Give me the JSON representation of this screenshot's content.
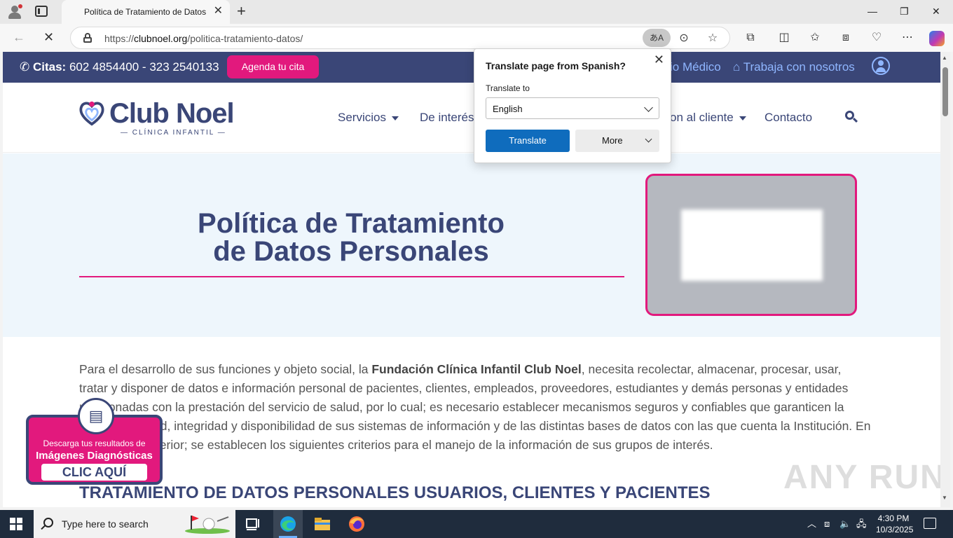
{
  "browser": {
    "tab_title": "Política de Tratamiento de Datos P",
    "url_prefix": "https://",
    "url_domain": "clubnoel.org",
    "url_path": "/politica-tratamiento-datos/",
    "translate_pill": "あA"
  },
  "topbar": {
    "citas_label": "Citas:",
    "phones": "602 4854400 - 323 2540133",
    "agenda_button": "Agenda tu cita",
    "link_medico": "io Médico",
    "link_trabaja": "Trabaja con nosotros"
  },
  "header": {
    "logo_name": "Club Noel",
    "logo_sub": "— CLÍNICA INFANTIL —",
    "menu": {
      "servicios": "Servicios",
      "interes": "De interés",
      "cliente": "on al cliente",
      "contacto": "Contacto"
    }
  },
  "hero": {
    "title_line1": "Política de Tratamiento",
    "title_line2": "de Datos Personales"
  },
  "content": {
    "para_intro": "Para el desarrollo de sus funciones y objeto social, la ",
    "para_bold": "Fundación Clínica Infantil Club Noel",
    "para_rest": ", necesita recolectar, almacenar, procesar, usar, tratar y disponer de datos e información personal de pacientes, clientes, empleados, proveedores, estudiantes y demás personas y entidades relacionadas con la prestación del servicio de salud, por lo cual; es necesario establecer mecanismos seguros y confiables que garanticen la confidencialidad, integridad y disponibilidad de sus sistemas de información y de las distintas bases de datos con las que cuenta la Institución. En virtud de lo anterior; se establecen los siguientes criterios para el manejo de la información de sus grupos de interés.",
    "section_title": "TRATAMIENTO DE DATOS PERSONALES USUARIOS, CLIENTES Y PACIENTES"
  },
  "promo": {
    "line1": "Descarga tus resultados de",
    "line2": "Imágenes Diagnósticas",
    "button": "CLIC AQUÍ"
  },
  "translate_popup": {
    "title": "Translate page from Spanish?",
    "label": "Translate to",
    "selected_language": "English",
    "translate_button": "Translate",
    "more_button": "More"
  },
  "watermark": "ANY RUN",
  "taskbar": {
    "search_placeholder": "Type here to search",
    "time": "4:30 PM",
    "date": "10/3/2025"
  },
  "colors": {
    "brand_navy": "#3a4677",
    "brand_pink": "#e2197d",
    "link_blue": "#8fb6ff",
    "edge_blue": "#0f6cbd"
  }
}
